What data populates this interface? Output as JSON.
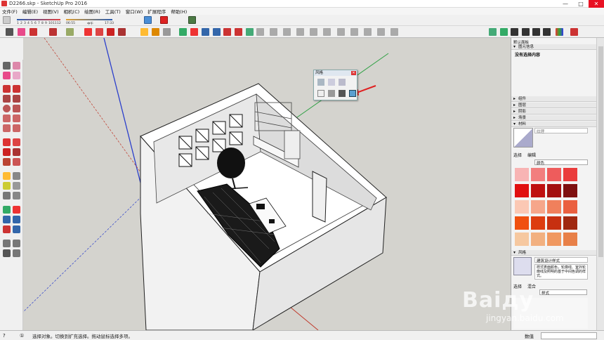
{
  "window": {
    "title": "D2266.skp - SketchUp Pro 2016",
    "controls": [
      "—",
      "□",
      "✕"
    ]
  },
  "menu": [
    "文件(F)",
    "编辑(E)",
    "视图(V)",
    "相机(C)",
    "绘图(R)",
    "工具(T)",
    "窗口(W)",
    "扩展程序",
    "帮助(H)"
  ],
  "toolbar1": {
    "layer_numbers": [
      "1",
      "2",
      "3",
      "4",
      "5",
      "6",
      "7",
      "8",
      "9",
      "10",
      "11",
      "12"
    ],
    "slider_labels": [
      "06:55",
      "中午",
      "17:33"
    ]
  },
  "style_window": {
    "title": "风格",
    "close": "✕"
  },
  "right_panel": {
    "title": "默认面板",
    "entity_info": "图元信息",
    "no_selection": "没有选择内容",
    "sections": [
      "组件",
      "图层",
      "阴影",
      "场景",
      "材料"
    ],
    "material_name": "纹理",
    "tabs": [
      "选择",
      "编辑"
    ],
    "color_dropdown": "颜色",
    "styles_header": "风格",
    "style_name": "建筑设计样式",
    "style_desc": "样式表面颜色，轮廓线、室外轮廓线及照明的基于中间色调的样式。",
    "styles_tabs": [
      "选择",
      "混合"
    ],
    "styles_dropdown": "样式",
    "swatch_colors": [
      [
        "#f8b4b4",
        "#f27e7e",
        "#ee5c5c",
        "#ea3c3c"
      ],
      [
        "#e11010",
        "#bf1010",
        "#a31010",
        "#7f1010"
      ],
      [
        "#fbc8b4",
        "#f6a68a",
        "#f0805c",
        "#ea6040"
      ],
      [
        "#f05010",
        "#dd3c10",
        "#c73010",
        "#a02810"
      ],
      [
        "#f6c8a0",
        "#f2b080",
        "#f09860",
        "#e88048"
      ]
    ]
  },
  "status": {
    "text": "选择对象。切换到扩充选择。拖动鼠标选择多项。",
    "measure_label": "数值",
    "icons": [
      "?",
      "①"
    ]
  },
  "watermark": {
    "brand": "Baiду",
    "site": "jingyan.baidu.com"
  },
  "colors": {
    "axis_red": "#c0392b",
    "axis_green": "#2ea043",
    "axis_blue": "#2b3fcb",
    "annotation_arrow": "#e02020"
  }
}
